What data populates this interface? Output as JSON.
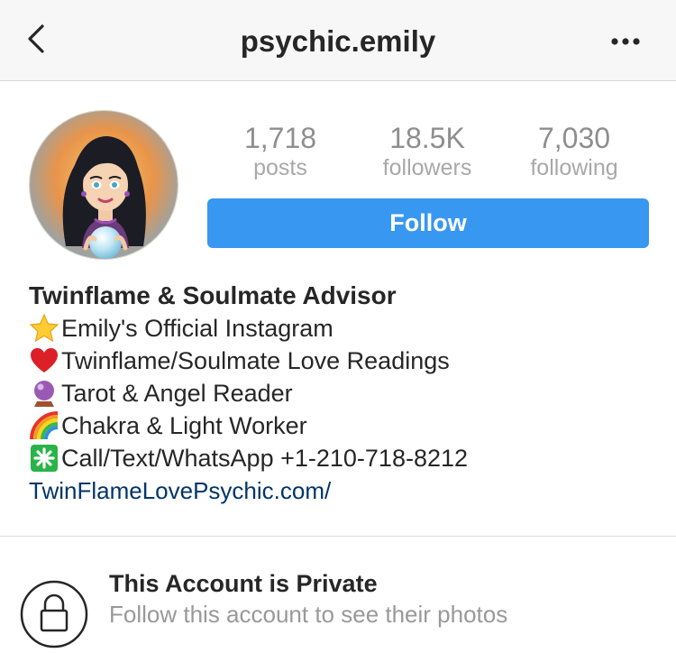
{
  "header": {
    "username": "psychic.emily",
    "back_icon": "chevron-left-icon",
    "more_icon": "ellipsis-icon"
  },
  "profile": {
    "avatar": "cartoon-psychic-woman-with-crystal-ball",
    "stats": [
      {
        "count": "1,718",
        "label": "posts"
      },
      {
        "count": "18.5K",
        "label": "followers"
      },
      {
        "count": "7,030",
        "label": "following"
      }
    ],
    "follow_label": "Follow"
  },
  "bio": {
    "name": "Twinflame & Soulmate Advisor",
    "lines": [
      {
        "icon": "star-emoji",
        "text": "Emily's Official Instagram"
      },
      {
        "icon": "heart-emoji",
        "text": "Twinflame/Soulmate Love Readings"
      },
      {
        "icon": "crystal-ball-emoji",
        "text": "Tarot & Angel Reader"
      },
      {
        "icon": "rainbow-emoji",
        "text": "Chakra & Light Worker"
      },
      {
        "icon": "sparkle-emoji",
        "text": "Call/Text/WhatsApp +1-210-718-8212"
      }
    ],
    "link": "TwinFlameLovePsychic.com/"
  },
  "private_notice": {
    "icon": "lock-icon",
    "title": "This Account is Private",
    "subtitle": "Follow this account to see their photos"
  },
  "colors": {
    "follow_button": "#3897f0",
    "link": "#003569",
    "navbar_bg": "#f7f7f7"
  }
}
